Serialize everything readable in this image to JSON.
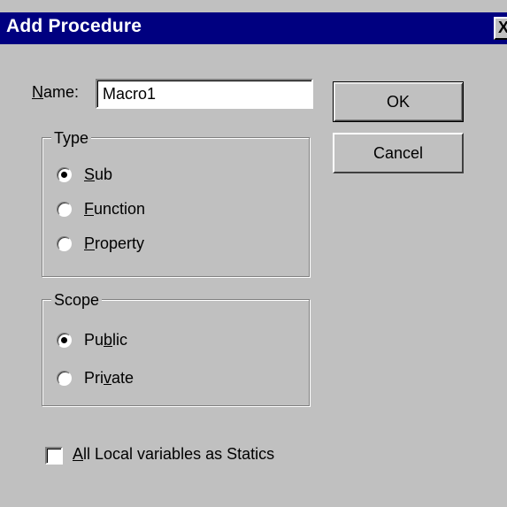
{
  "window": {
    "title": "Add Procedure",
    "close_glyph": "X"
  },
  "name": {
    "label_accel": "N",
    "label_rest": "ame:",
    "value": "Macro1"
  },
  "buttons": {
    "ok": "OK",
    "cancel": "Cancel"
  },
  "type_group": {
    "caption": "Type",
    "options": [
      {
        "pre": "",
        "accel": "S",
        "post": "ub",
        "selected": true
      },
      {
        "pre": "",
        "accel": "F",
        "post": "unction",
        "selected": false
      },
      {
        "pre": "",
        "accel": "P",
        "post": "roperty",
        "selected": false
      }
    ]
  },
  "scope_group": {
    "caption": "Scope",
    "options": [
      {
        "pre": "Pu",
        "accel": "b",
        "post": "lic",
        "selected": true
      },
      {
        "pre": "Pri",
        "accel": "v",
        "post": "ate",
        "selected": false
      }
    ]
  },
  "statics": {
    "accel": "A",
    "rest": "ll Local variables as Statics",
    "checked": false
  },
  "colors": {
    "title_bar": "#000080",
    "face": "#c0c0c0"
  }
}
